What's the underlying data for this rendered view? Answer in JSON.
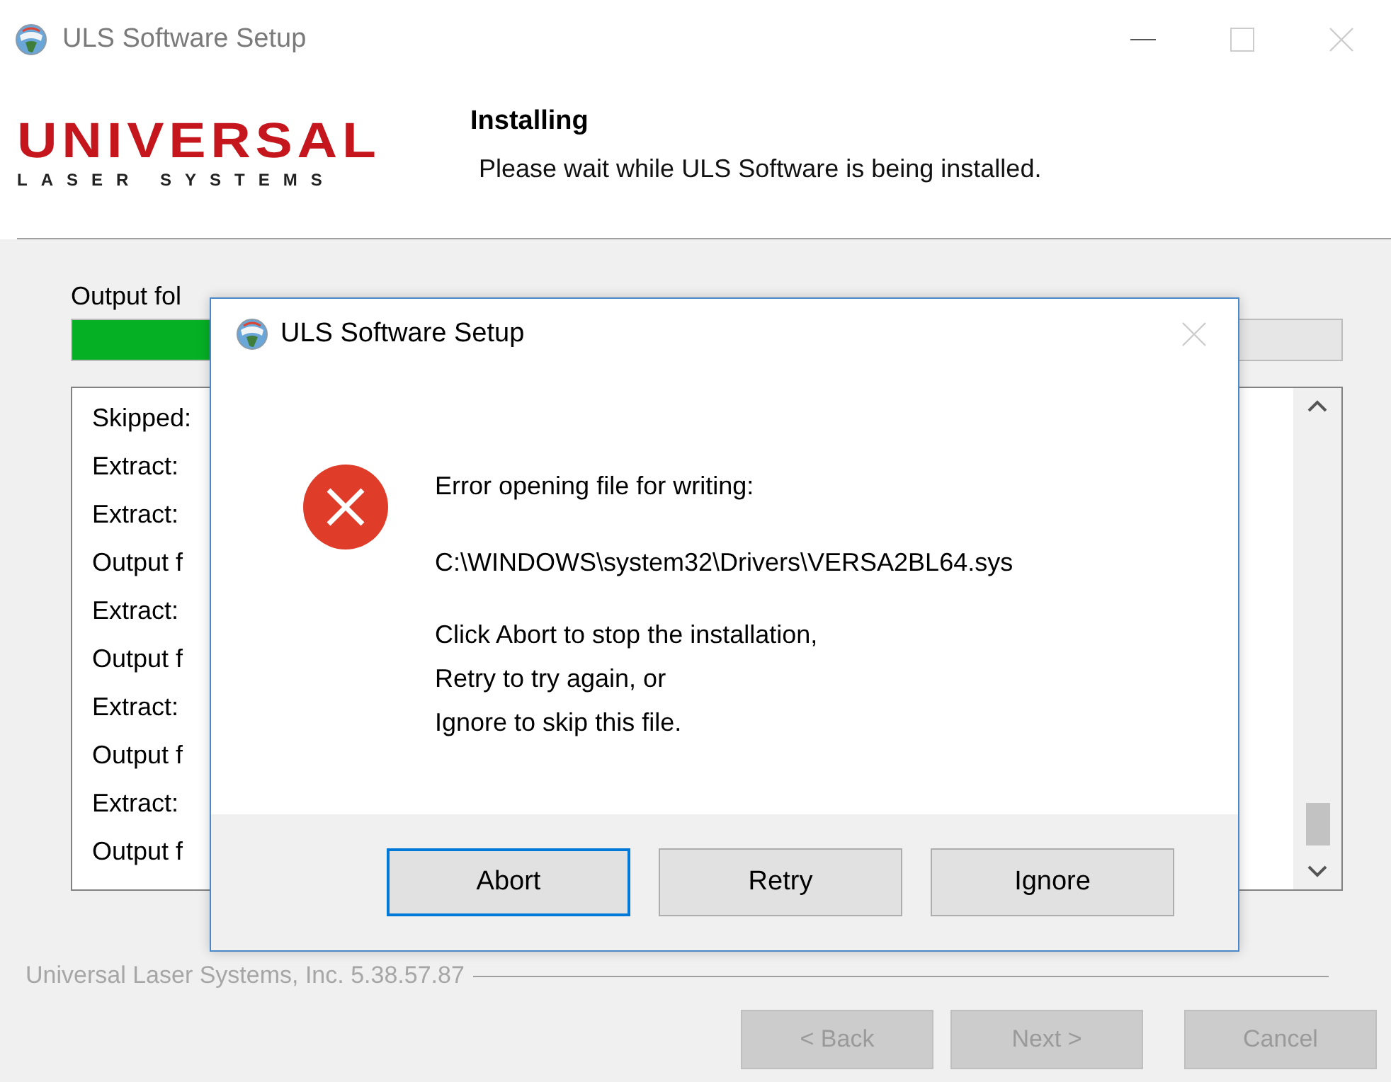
{
  "window": {
    "title": "ULS Software Setup"
  },
  "logo": {
    "name": "UNIVERSAL",
    "tagline": "LASER SYSTEMS"
  },
  "header": {
    "title": "Installing",
    "subtitle": "Please wait while ULS Software is being installed."
  },
  "progress": {
    "label": "Output fol",
    "level": 0.3
  },
  "log": {
    "lines": [
      "Skipped:",
      "Extract:",
      "Extract:",
      "Output f",
      "Extract:",
      "Output f",
      "Extract:",
      "Output f",
      "Extract:",
      "Output f"
    ]
  },
  "footer": {
    "brand": "Universal Laser Systems, Inc. 5.38.57.87"
  },
  "buttons": [
    {
      "label": "< Back",
      "disabled": true
    },
    {
      "label": "Next >",
      "disabled": true
    },
    {
      "label": "Cancel",
      "disabled": true
    }
  ],
  "dialog": {
    "title": "ULS Software Setup",
    "message": "Error opening file for writing:",
    "path": "C:\\WINDOWS\\system32\\Drivers\\VERSA2BL64.sys",
    "instructions": [
      "Click Abort to stop the installation,",
      "Retry to try again, or",
      "Ignore to skip this file."
    ],
    "buttons": [
      {
        "label": "Abort",
        "focused": true
      },
      {
        "label": "Retry",
        "focused": false
      },
      {
        "label": "Ignore",
        "focused": false
      }
    ]
  }
}
